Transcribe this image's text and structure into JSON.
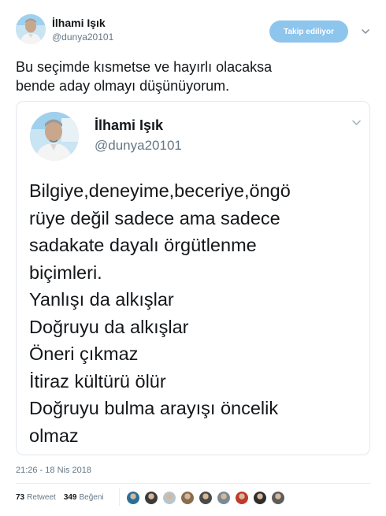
{
  "tweet": {
    "author_name": "İlhami Işık",
    "author_handle": "@dunya20101",
    "follow_label": "Takip ediliyor",
    "text": "Bu seçimde kısmetse ve hayırlı olacaksa\nbende aday olmayı düşünüyorum.",
    "timestamp": "21:26 - 18 Nis 2018",
    "retweet_count": "73",
    "retweet_label": "Retweet",
    "like_count": "349",
    "like_label": "Beğeni"
  },
  "quote": {
    "author_name": "İlhami Işık",
    "author_handle": "@dunya20101",
    "lines": [
      "Bilgiye,deneyime,beceriye,öngö",
      "rüye değil sadece ama sadece",
      "sadakate dayalı örgütlenme",
      "biçimleri.",
      "Yanlışı da alkışlar",
      "Doğruyu da alkışlar",
      "Öneri çıkmaz",
      "İtiraz kültürü ölür",
      "Doğruyu bulma arayışı öncelik",
      "olmaz"
    ]
  },
  "likers": [
    {
      "icon": "liker-avatar",
      "color": "#2a6f97"
    },
    {
      "icon": "liker-avatar",
      "color": "#3b3b3b"
    },
    {
      "icon": "liker-avatar",
      "color": "#b9c4cc"
    },
    {
      "icon": "liker-avatar",
      "color": "#8a6d4f"
    },
    {
      "icon": "liker-avatar",
      "color": "#4a4a4a"
    },
    {
      "icon": "liker-avatar",
      "color": "#7a8a94"
    },
    {
      "icon": "liker-avatar",
      "color": "#c0392b"
    },
    {
      "icon": "liker-avatar",
      "color": "#2d2d2d"
    },
    {
      "icon": "liker-avatar",
      "color": "#5c5c5c"
    }
  ],
  "colors": {
    "follow_button": "#8ec5ed",
    "secondary_text": "#657786",
    "border": "#e1e8ed"
  }
}
